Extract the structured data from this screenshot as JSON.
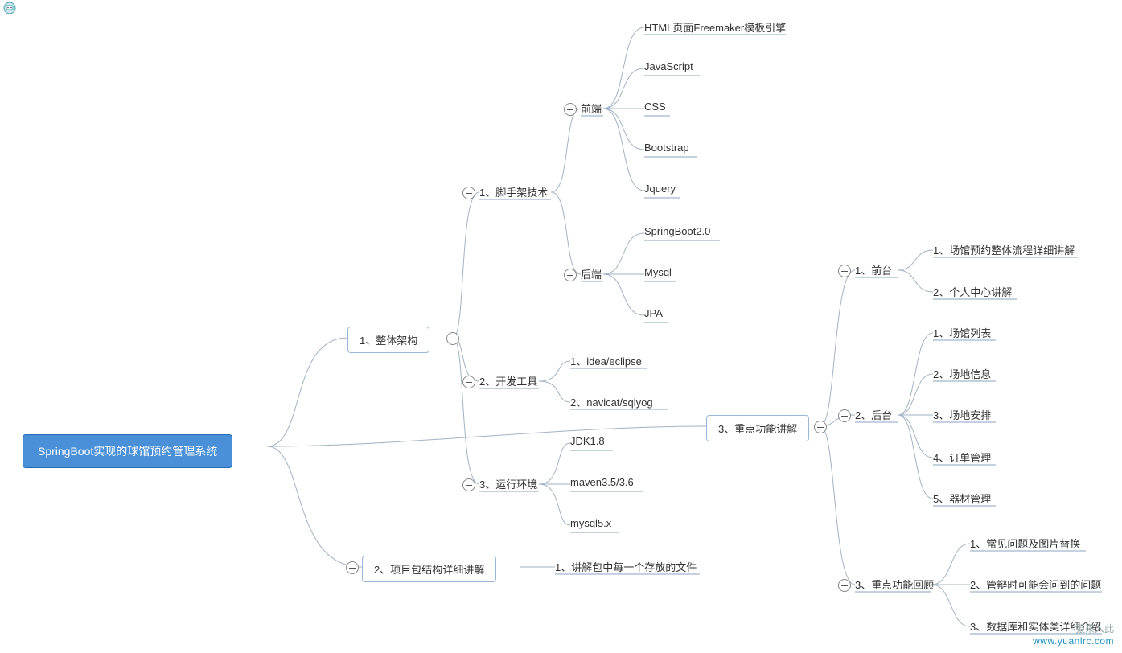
{
  "root": "SpringBoot实现的球馆预约管理系统",
  "nodes": {
    "l1_1": "1、整体架构",
    "l1_2": "2、项目包结构详细讲解",
    "l1_3": "3、重点功能讲解",
    "a1": "1、脚手架技术",
    "a2": "2、开发工具",
    "a3": "3、运行环境",
    "fe": "前端",
    "be": "后端",
    "fe1": "HTML页面Freemaker模板引擎",
    "fe2": "JavaScript",
    "fe3": "CSS",
    "fe4": "Bootstrap",
    "fe5": "Jquery",
    "be1": "SpringBoot2.0",
    "be2": "Mysql",
    "be3": "JPA",
    "t1": "1、idea/eclipse",
    "t2": "2、navicat/sqlyog",
    "r1": "JDK1.8",
    "r2": "maven3.5/3.6",
    "r3": "mysql5.x",
    "p1": "1、讲解包中每一个存放的文件",
    "k1": "1、前台",
    "k2": "2、后台",
    "k3": "3、重点功能回顾",
    "k1a": "1、场馆预约整体流程详细讲解",
    "k1b": "2、个人中心讲解",
    "k2a": "1、场馆列表",
    "k2b": "2、场地信息",
    "k2c": "3、场地安排",
    "k2d": "4、订单管理",
    "k2e": "5、器材管理",
    "k3a": "1、常见问题及图片替换",
    "k3b": "2、管辩时可能会问到的问题",
    "k3c": "3、数据库和实体类详细介绍"
  },
  "watermark": {
    "line1": "猿来入此",
    "line2": "www.yuanlrc.com"
  },
  "colors": {
    "rootFill": "#4a90d9",
    "border": "#9ab8d6",
    "curve": "#a2b3c5",
    "underline": "#7a97b5"
  }
}
